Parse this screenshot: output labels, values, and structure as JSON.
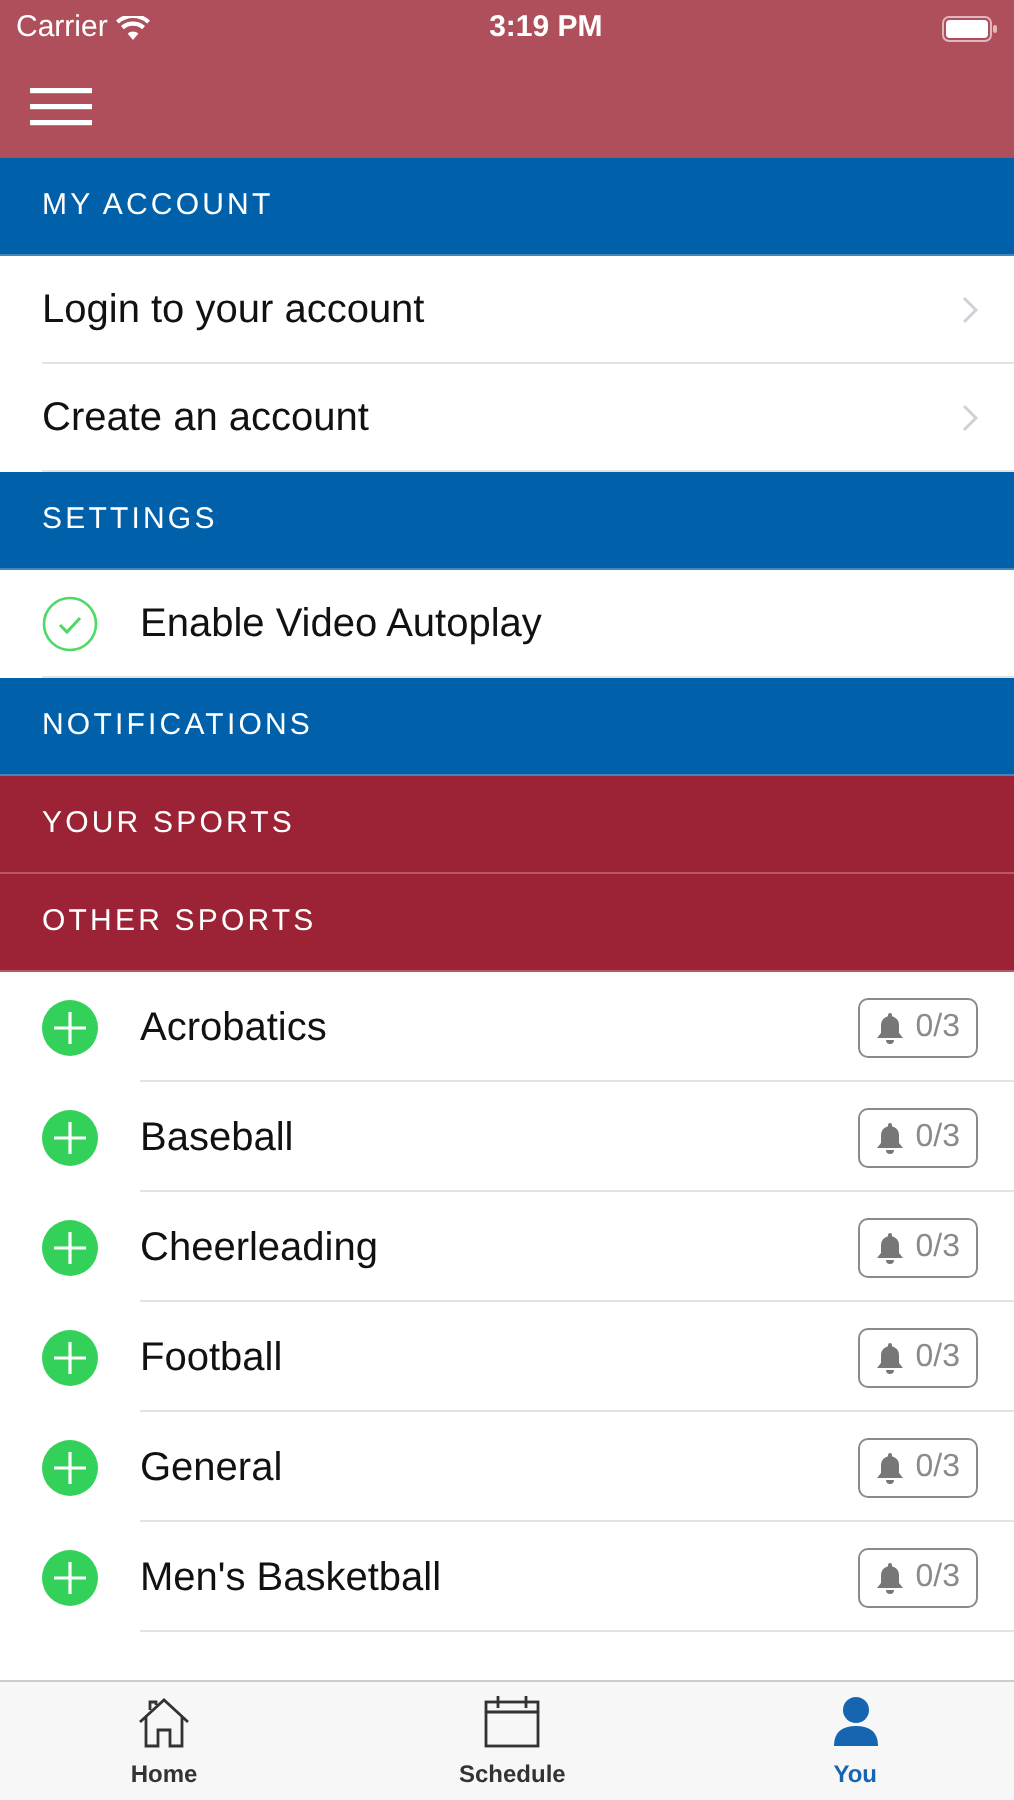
{
  "status_bar": {
    "carrier": "Carrier",
    "time": "3:19 PM"
  },
  "sections": [
    {
      "title": "MY ACCOUNT",
      "color": "#0061aa",
      "items": [
        {
          "kind": "link",
          "label": "Login to your account"
        },
        {
          "kind": "link",
          "label": "Create an account"
        }
      ]
    },
    {
      "title": "SETTINGS",
      "color": "#0061aa",
      "items": [
        {
          "kind": "toggle",
          "label": "Enable Video Autoplay",
          "checked": true
        }
      ]
    },
    {
      "title": "NOTIFICATIONS",
      "color": "#0061aa"
    },
    {
      "title": "YOUR SPORTS",
      "color": "#9b2335"
    },
    {
      "title": "OTHER SPORTS",
      "color": "#9b2335",
      "items": [
        {
          "kind": "sport",
          "label": "Acrobatics",
          "count": "0/3"
        },
        {
          "kind": "sport",
          "label": "Baseball",
          "count": "0/3"
        },
        {
          "kind": "sport",
          "label": "Cheerleading",
          "count": "0/3"
        },
        {
          "kind": "sport",
          "label": "Football",
          "count": "0/3"
        },
        {
          "kind": "sport",
          "label": "General",
          "count": "0/3"
        },
        {
          "kind": "sport",
          "label": "Men's Basketball",
          "count": "0/3"
        }
      ]
    }
  ],
  "tabs": [
    {
      "label": "Home",
      "selected": false
    },
    {
      "label": "Schedule",
      "selected": false
    },
    {
      "label": "You",
      "selected": true
    }
  ]
}
